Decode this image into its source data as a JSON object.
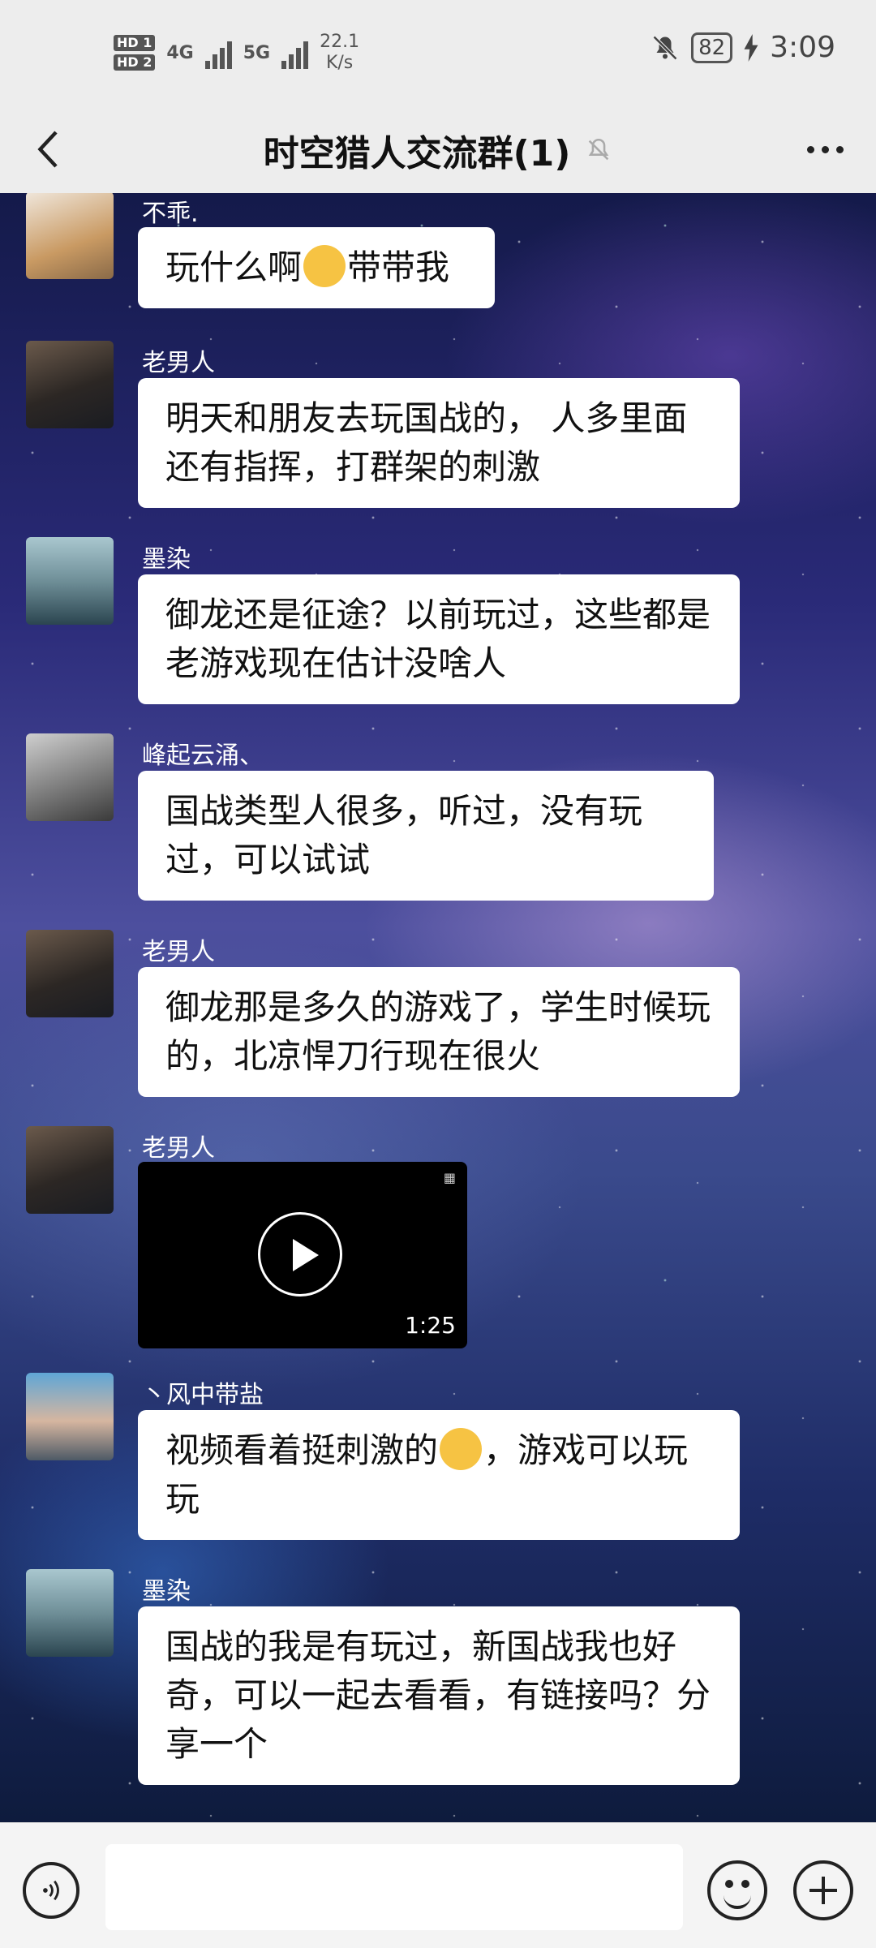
{
  "status_bar": {
    "hd1": "HD 1",
    "hd2": "HD 2",
    "net1": "4G",
    "net2": "5G",
    "speed_value": "22.1",
    "speed_unit": "K/s",
    "battery": "82",
    "time": "3:09",
    "icons": [
      "silent-bell-icon",
      "charging-icon"
    ]
  },
  "header": {
    "title": "时空猎人交流群(1)",
    "icons": [
      "back-arrow-icon",
      "muted-bell-icon",
      "more-icon"
    ]
  },
  "messages": [
    {
      "sender": "不乖.",
      "text_a": "玩什么啊",
      "emoji": "smirk-emoji",
      "text_b": "带带我"
    },
    {
      "sender": "老男人",
      "text": "明天和朋友去玩国战的， 人多里面还有指挥，打群架的刺激"
    },
    {
      "sender": "墨染",
      "text": "御龙还是征途？以前玩过，这些都是老游戏现在估计没啥人"
    },
    {
      "sender": "峰起云涌、",
      "text": "国战类型人很多，听过，没有玩过，可以试试"
    },
    {
      "sender": "老男人",
      "text": "御龙那是多久的游戏了，学生时候玩的，北凉悍刀行现在很火"
    },
    {
      "sender": "老男人",
      "type": "video",
      "duration": "1:25"
    },
    {
      "sender": "丶风中带盐",
      "text_a": "视频看着挺刺激的",
      "emoji": "grin-emoji",
      "text_b": "，游戏可以玩玩"
    },
    {
      "sender": "墨染",
      "text": "国战的我是有玩过，新国战我也好奇，可以一起去看看，有链接吗？分享一个"
    }
  ],
  "input_bar": {
    "icons": [
      "voice-icon",
      "emoji-icon",
      "plus-icon"
    ]
  }
}
